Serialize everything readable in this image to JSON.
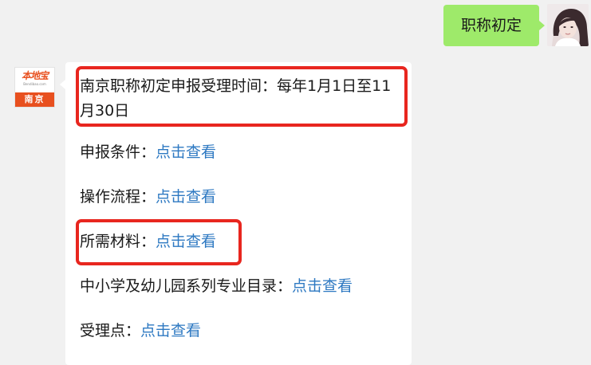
{
  "user_message": {
    "text": "职称初定"
  },
  "bot": {
    "logo_text": "本地宝",
    "logo_url": "Bendibao.com",
    "logo_city": "南京"
  },
  "reply": {
    "time_line": "南京职称初定申报受理时间：每年1月1日至11月30日",
    "items": [
      {
        "label": "申报条件：",
        "link": "点击查看"
      },
      {
        "label": "操作流程：",
        "link": "点击查看"
      },
      {
        "label": "所需材料：",
        "link": "点击查看"
      },
      {
        "label": "中小学及幼儿园系列专业目录：",
        "link": "点击查看"
      },
      {
        "label": "受理点：",
        "link": "点击查看"
      }
    ]
  },
  "colors": {
    "chat_background": "#f1f1f1",
    "user_bubble": "#9eea6a",
    "reply_bubble": "#ffffff",
    "link": "#2e79c2",
    "highlight_box": "#e8261f",
    "logo_orange": "#e8501f"
  },
  "icons": {
    "user_avatar": "user-photo-avatar",
    "bot_avatar": "bendibao-logo"
  }
}
